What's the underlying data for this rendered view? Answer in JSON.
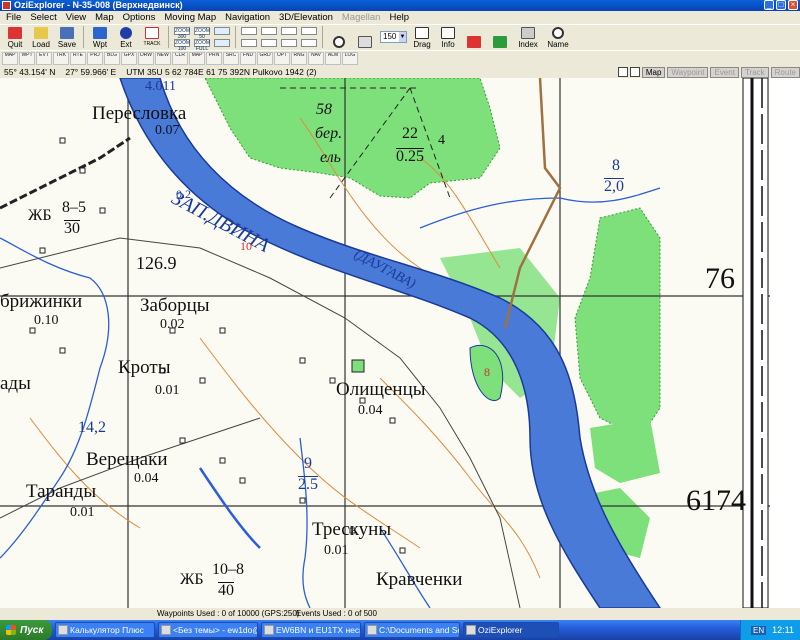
{
  "window": {
    "title": "OziExplorer - N-35-008 (Верхнедвинск)",
    "controls": [
      "_",
      "□",
      "×"
    ]
  },
  "menu": [
    {
      "label": "File",
      "enabled": true
    },
    {
      "label": "Select",
      "enabled": true
    },
    {
      "label": "View",
      "enabled": true
    },
    {
      "label": "Map",
      "enabled": true
    },
    {
      "label": "Options",
      "enabled": true
    },
    {
      "label": "Moving Map",
      "enabled": true
    },
    {
      "label": "Navigation",
      "enabled": true
    },
    {
      "label": "3D/Elevation",
      "enabled": true
    },
    {
      "label": "Magellan",
      "enabled": false
    },
    {
      "label": "Help",
      "enabled": true
    }
  ],
  "toolbar": {
    "quit": "Quit",
    "load": "Load",
    "save": "Save",
    "wpt": "Wpt",
    "ext": "Ext",
    "drag": "Drag",
    "info": "Info",
    "index": "Index",
    "name": "Name",
    "zoom_value": "150",
    "zoom_buttons": [
      "ZOOM 300",
      "ZOOM 100",
      "ZOOM 50",
      "ZOOM FULL"
    ],
    "trace_label": "TRACK"
  },
  "toolbar2_items": [
    "MAP",
    "WPT",
    "EVT",
    "TRK",
    "RTE",
    "PRJ",
    "BLG",
    "GPX",
    "DRW",
    "NEW",
    "CLR",
    "MAP",
    "PRN",
    "SRC",
    "FND",
    "GRD",
    "OPT",
    "RNG",
    "NAV",
    "ALM",
    "LOG"
  ],
  "status": {
    "lat": "55° 43.154' N",
    "lon": "27° 59.966' E",
    "utm": "UTM  35U   5 62 784E   61 75 392N  Pulkovo 1942 (2)",
    "tabs": [
      {
        "label": "Map",
        "enabled": true
      },
      {
        "label": "Waypoint",
        "enabled": false
      },
      {
        "label": "Event",
        "enabled": false
      },
      {
        "label": "Track",
        "enabled": false
      },
      {
        "label": "Route",
        "enabled": false
      }
    ]
  },
  "map_labels": {
    "perslovka": "Пересловка",
    "perslovka_v": "0.07",
    "zhb1": "ЖБ",
    "zhb1_num": "8–5",
    "zhb1_den": "30",
    "h126": "126.9",
    "hgt_4011": "4.011",
    "river1": "ЗАП.ДВИНА",
    "river2": "(ДАУГАВА)",
    "forest": "58",
    "forest_b": "бер.",
    "forest_e": "ель",
    "frac22_n": "22",
    "frac22_d": "0.25",
    "frac22_4": "4",
    "frac8_n": "8",
    "frac8_d": "2,0",
    "river_02": "0.2",
    "river_10": "10",
    "grid76": "76",
    "grid74": "6174",
    "brizhinki": "брижинки",
    "brizhinki_v": "0.10",
    "zaborcy": "Заборцы",
    "zaborcy_v": "0.02",
    "kroty": "Кроты",
    "kroty_v": "0.01",
    "ady": "ады",
    "olishency": "Олищенцы",
    "olishency_v": "0.04",
    "river_8": "8",
    "num142": "14,2",
    "vereshchaki": "Верещаки",
    "vereshchaki_v": "0.04",
    "tarandy": "Таранды",
    "tarandy_v": "0.01",
    "frac9_n": "9",
    "frac9_d": "2.5",
    "treskuny": "Трескуны",
    "treskuny_v": "0.01",
    "zhb2": "ЖБ",
    "zhb2_num": "10–8",
    "zhb2_den": "40",
    "kravchenki": "Кравченки"
  },
  "bottom": {
    "waypoints": "Waypoints Used : 0 of 10000  (GPS:250)",
    "events": "Events Used : 0 of 500"
  },
  "taskbar": {
    "start": "Пуск",
    "items": [
      {
        "label": "Калькулятор Плюс",
        "active": false
      },
      {
        "label": "<Без темы> - ew1do@o...",
        "active": false
      },
      {
        "label": "EW6BN и EU1TX неско...",
        "active": false
      },
      {
        "label": "C:\\Documents and Settin...",
        "active": false
      },
      {
        "label": "OziExplorer",
        "active": true
      }
    ],
    "lang": "EN",
    "clock": "12:11"
  },
  "colors": {
    "forest": "#7de07a",
    "river": "#3c6bd0",
    "contour": "#e08a3a",
    "stream": "#2a5fd8"
  }
}
